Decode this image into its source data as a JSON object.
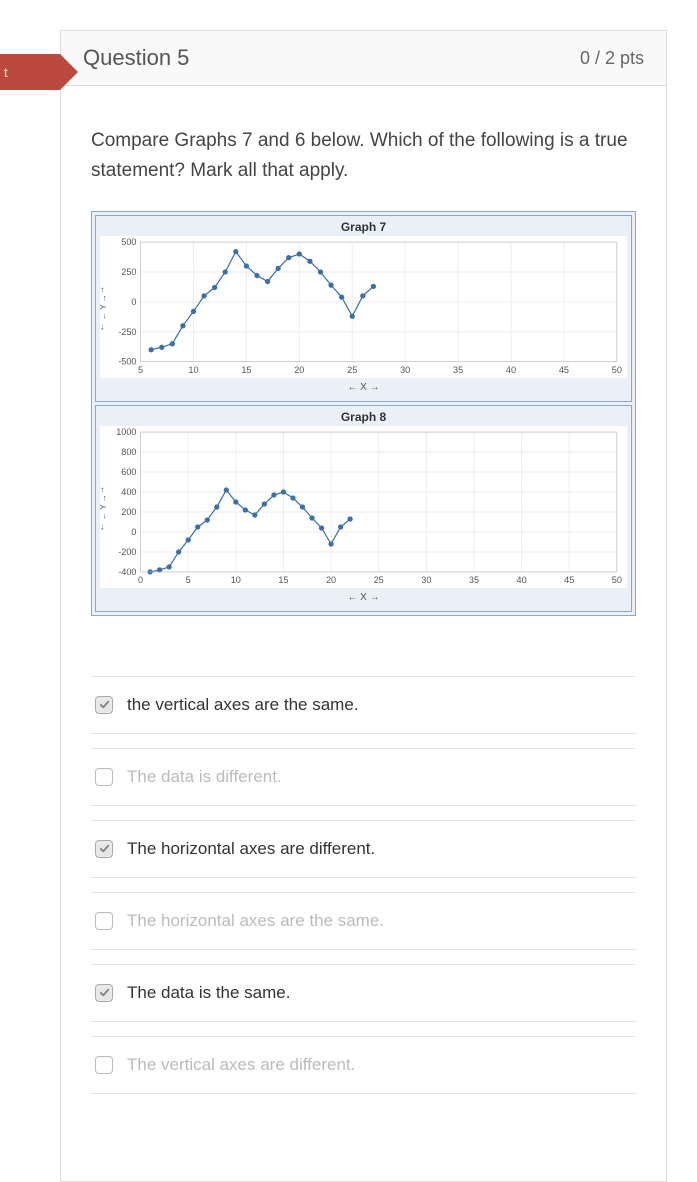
{
  "flag_label": "t",
  "header": {
    "title": "Question 5",
    "points": "0 / 2 pts"
  },
  "prompt": "Compare Graphs 7 and 6 below. Which of the following is a true statement? Mark all that apply.",
  "chart_data": [
    {
      "type": "line",
      "title": "Graph 7",
      "xlabel": "← X →",
      "ylabel": "← Y →",
      "xlim": [
        5,
        50
      ],
      "ylim": [
        -500,
        500
      ],
      "xticks": [
        5,
        10,
        15,
        20,
        25,
        30,
        35,
        40,
        45,
        50
      ],
      "yticks": [
        -500,
        -250,
        0,
        250,
        500
      ],
      "x": [
        6,
        7,
        8,
        9,
        10,
        11,
        12,
        13,
        14,
        15,
        16,
        17,
        18,
        19,
        20,
        21,
        22,
        23,
        24,
        25,
        26,
        27
      ],
      "values": [
        -400,
        -380,
        -350,
        -200,
        -80,
        50,
        120,
        250,
        420,
        300,
        220,
        170,
        280,
        370,
        400,
        340,
        250,
        140,
        40,
        -120,
        50,
        130
      ]
    },
    {
      "type": "line",
      "title": "Graph 8",
      "xlabel": "← X →",
      "ylabel": "← Y →",
      "xlim": [
        0,
        50
      ],
      "ylim": [
        -400,
        1000
      ],
      "xticks": [
        0,
        5,
        10,
        15,
        20,
        25,
        30,
        35,
        40,
        45,
        50
      ],
      "yticks": [
        -400,
        -200,
        0,
        200,
        400,
        600,
        800,
        1000
      ],
      "x": [
        1,
        2,
        3,
        4,
        5,
        6,
        7,
        8,
        9,
        10,
        11,
        12,
        13,
        14,
        15,
        16,
        17,
        18,
        19,
        20,
        21,
        22
      ],
      "values": [
        -400,
        -380,
        -350,
        -200,
        -80,
        50,
        120,
        250,
        420,
        300,
        220,
        170,
        280,
        370,
        400,
        340,
        250,
        140,
        40,
        -120,
        50,
        130
      ]
    }
  ],
  "answers": [
    {
      "label": "the vertical axes are the same.",
      "checked": true
    },
    {
      "label": "The data is different.",
      "checked": false
    },
    {
      "label": "The horizontal axes are different.",
      "checked": true
    },
    {
      "label": "The horizontal axes are the same.",
      "checked": false
    },
    {
      "label": "The data is the same.",
      "checked": true
    },
    {
      "label": "The vertical axes are different.",
      "checked": false
    }
  ]
}
